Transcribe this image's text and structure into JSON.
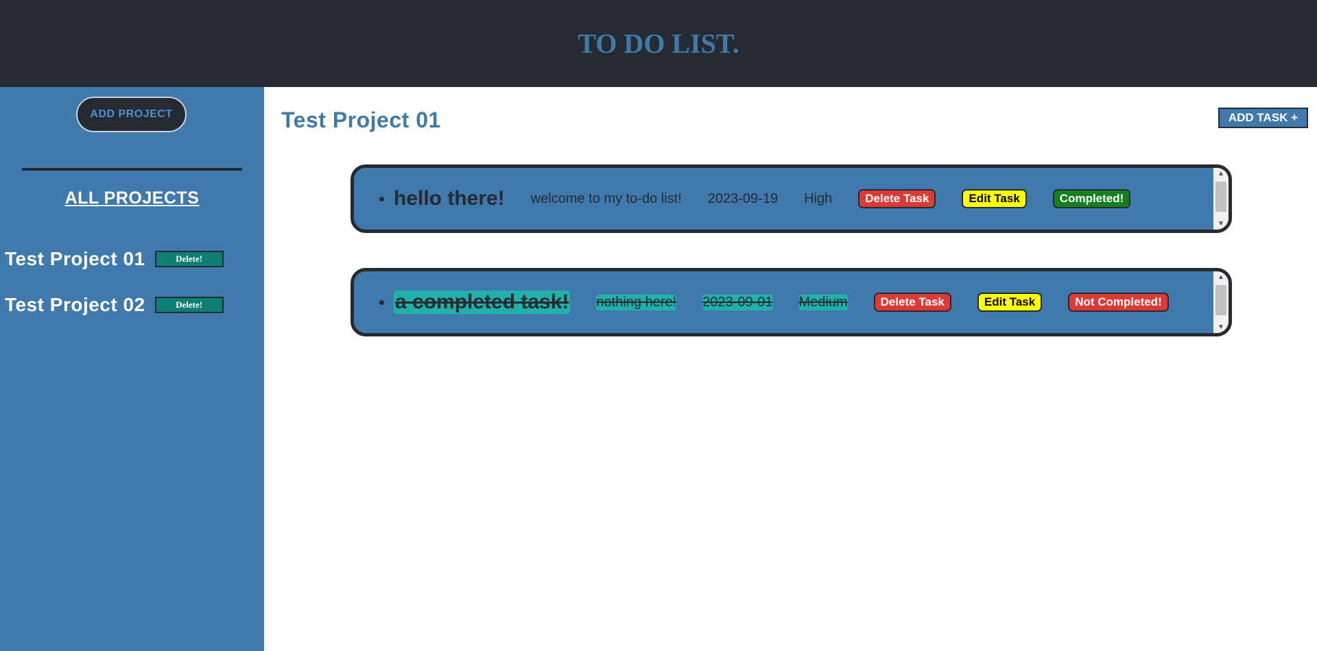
{
  "header": {
    "title": "TO DO LIST."
  },
  "sidebar": {
    "add_project_label": "ADD PROJECT",
    "all_projects_label": "ALL PROJECTS",
    "projects": [
      {
        "name": "Test Project 01",
        "delete_label": "Delete!"
      },
      {
        "name": "Test Project 02",
        "delete_label": "Delete!"
      }
    ]
  },
  "main": {
    "title": "Test Project 01",
    "add_task_label": "ADD TASK +",
    "tasks": [
      {
        "title": "hello there!",
        "description": "welcome to my to-do list!",
        "date": "2023-09-19",
        "priority": "High",
        "delete_label": "Delete Task",
        "edit_label": "Edit Task",
        "status_label": "Completed!",
        "completed": false
      },
      {
        "title": "a completed task!",
        "description": "nothing here!",
        "date": "2023-09-01",
        "priority": "Medium",
        "delete_label": "Delete Task",
        "edit_label": "Edit Task",
        "status_label": "Not Completed!",
        "completed": true
      }
    ]
  },
  "colors": {
    "header_bg": "#262a33",
    "accent": "#4079ab",
    "delete": "#de3a35",
    "edit": "#ffff00",
    "complete": "#14801e",
    "completed_highlight": "#20b2aa"
  },
  "icons": {
    "scroll_up": "scroll-up-arrow-icon",
    "scroll_down": "scroll-down-arrow-icon"
  }
}
